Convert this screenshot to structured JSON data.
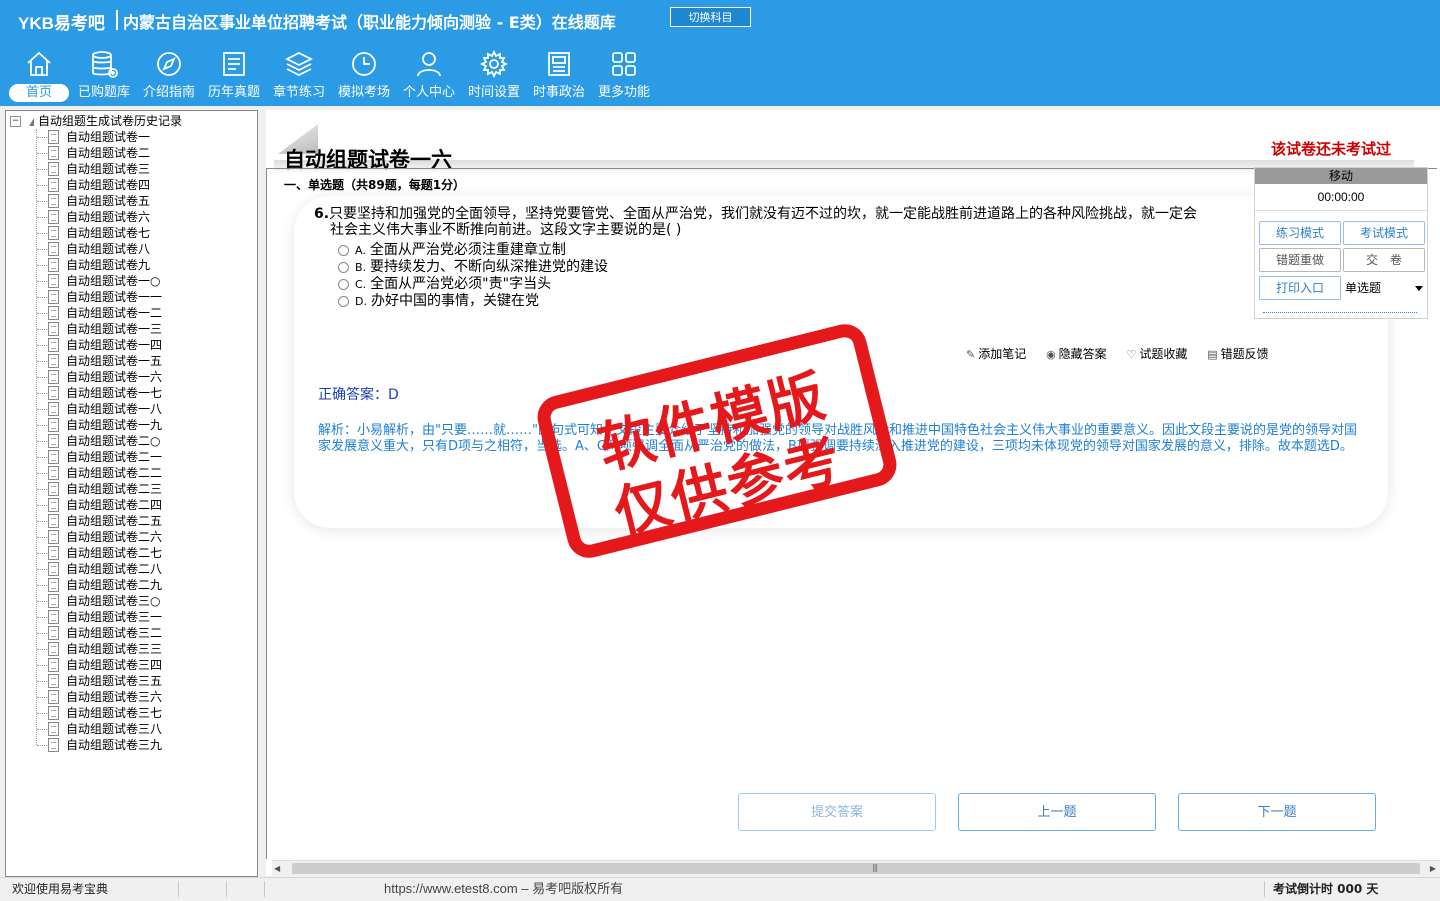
{
  "header": {
    "logo": "YKB易考吧",
    "title": "内蒙古自治区事业单位招聘考试（职业能力倾向测验 - E类）在线题库",
    "switch_label": "切换科目"
  },
  "nav": [
    {
      "label": "首页",
      "icon": "home-icon"
    },
    {
      "label": "已购题库",
      "icon": "database-icon"
    },
    {
      "label": "介绍指南",
      "icon": "compass-icon"
    },
    {
      "label": "历年真题",
      "icon": "document-icon"
    },
    {
      "label": "章节练习",
      "icon": "layers-icon"
    },
    {
      "label": "模拟考场",
      "icon": "clock-icon"
    },
    {
      "label": "个人中心",
      "icon": "user-icon"
    },
    {
      "label": "时间设置",
      "icon": "gear-icon"
    },
    {
      "label": "时事政治",
      "icon": "news-icon"
    },
    {
      "label": "更多功能",
      "icon": "grid-icon"
    }
  ],
  "sidebar": {
    "root": "自动组题生成试卷历史记录",
    "items": [
      "自动组题试卷一",
      "自动组题试卷二",
      "自动组题试卷三",
      "自动组题试卷四",
      "自动组题试卷五",
      "自动组题试卷六",
      "自动组题试卷七",
      "自动组题试卷八",
      "自动组题试卷九",
      "自动组题试卷一○",
      "自动组题试卷一一",
      "自动组题试卷一二",
      "自动组题试卷一三",
      "自动组题试卷一四",
      "自动组题试卷一五",
      "自动组题试卷一六",
      "自动组题试卷一七",
      "自动组题试卷一八",
      "自动组题试卷一九",
      "自动组题试卷二○",
      "自动组题试卷二一",
      "自动组题试卷二二",
      "自动组题试卷二三",
      "自动组题试卷二四",
      "自动组题试卷二五",
      "自动组题试卷二六",
      "自动组题试卷二七",
      "自动组题试卷二八",
      "自动组题试卷二九",
      "自动组题试卷三○",
      "自动组题试卷三一",
      "自动组题试卷三二",
      "自动组题试卷三三",
      "自动组题试卷三四",
      "自动组题试卷三五",
      "自动组题试卷三六",
      "自动组题试卷三七",
      "自动组题试卷三八",
      "自动组题试卷三九"
    ]
  },
  "paper": {
    "title": "自动组题试卷一六",
    "status": "该试卷还未考试过",
    "section": "一、单选题（共89题，每题1分）"
  },
  "question": {
    "number": "6.",
    "text": "只要坚持和加强党的全面领导，坚持党要管党、全面从严治党，我们就没有迈不过的坎，就一定能战胜前进道路上的各种风险挑战，就一定会",
    "text2": "社会主义伟大事业不断推向前进。这段文字主要说的是( )",
    "options": [
      {
        "key": "A.",
        "text": "全面从严治党必须注重建章立制"
      },
      {
        "key": "B.",
        "text": "要持续发力、不断向纵深推进党的建设"
      },
      {
        "key": "C.",
        "text": "全面从严治党必须\"责\"字当头"
      },
      {
        "key": "D.",
        "text": "办好中国的事情，关键在党"
      }
    ],
    "actions": {
      "note": "添加笔记",
      "hide": "隐藏答案",
      "fav": "试题收藏",
      "report": "错题反馈"
    },
    "answer": "正确答案：D",
    "analysis": "解析：小易解析，由\"只要……就……\"的句式可知，文段主要介绍了坚持和加强党的领导对战胜风险和推进中国特色社会主义伟大事业的重要意义。因此文段主要说的是党的领导对国家发展意义重大，只有D项与之相符，当选。A、C两项强调全面从严治党的做法，B项强调要持续深入推进党的建设，三项均未体现党的领导对国家发展的意义，排除。故本题选D。"
  },
  "buttons": {
    "submit": "提交答案",
    "prev": "上一题",
    "next": "下一题"
  },
  "panel": {
    "move": "移动",
    "timer": "00:00:00",
    "practice": "练习模式",
    "exam": "考试模式",
    "redo": "错题重做",
    "handin": "交　卷",
    "print": "打印入口",
    "type_select": "单选题"
  },
  "stamp": {
    "line1": "软件模版",
    "line2": "仅供参考"
  },
  "status": {
    "welcome": "欢迎使用易考宝典",
    "copyright": "https://www.etest8.com – 易考吧版权所有",
    "countdown": "考试倒计时 000 天"
  },
  "colors": {
    "header": "#2b9be6",
    "accent_red": "#cc0000",
    "answer_blue": "#1a3fb8",
    "analysis_blue": "#1e7fd6"
  }
}
